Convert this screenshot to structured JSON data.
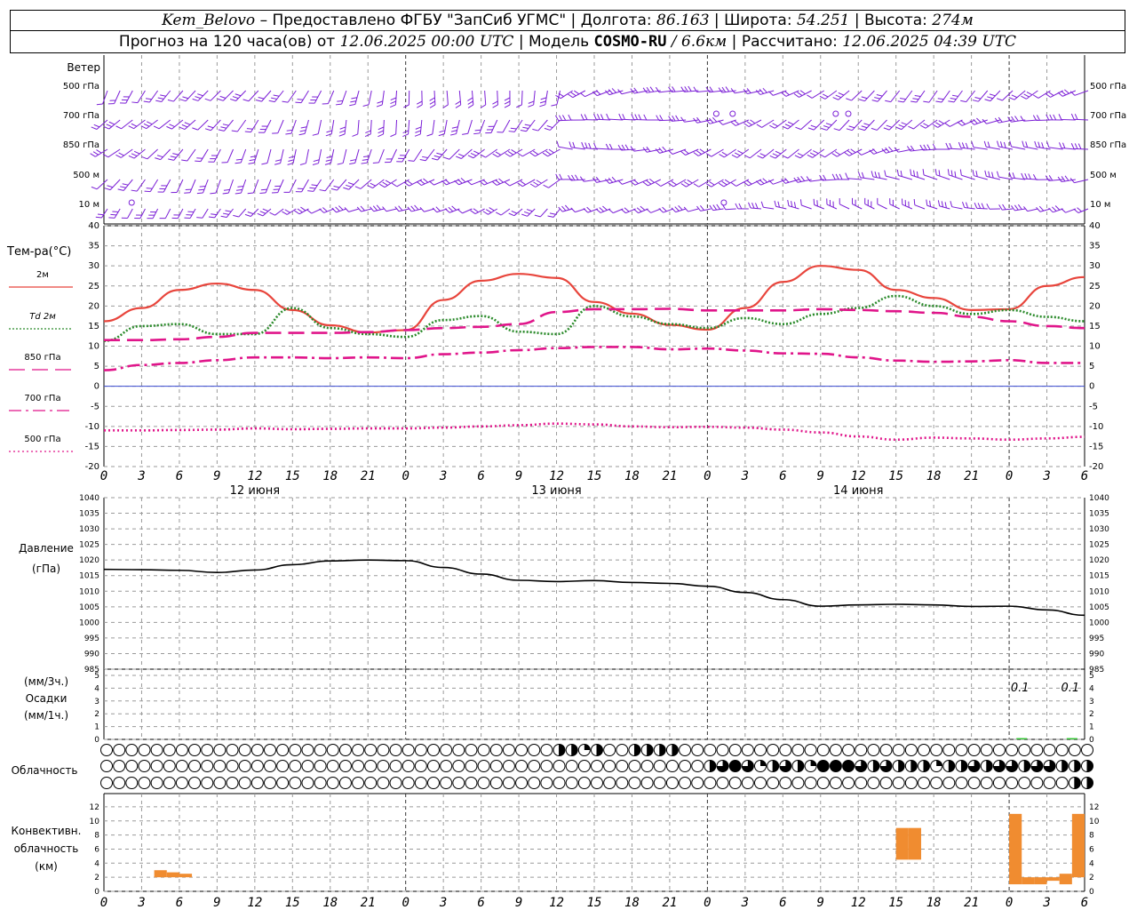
{
  "header": {
    "station": "Kem_Belovo",
    "provider": "– Предоставлено ФГБУ \"ЗапСиб УГМС\"",
    "lon_label": "Долгота:",
    "lon_value": "86.163",
    "lat_label": "Широта:",
    "lat_value": "54.251",
    "alt_label": "Высота:",
    "alt_value": "274м",
    "forecast_label": "Прогноз на 120 часа(ов) от",
    "forecast_start": "12.06.2025 00:00 UTC",
    "model_label": "Модель",
    "model_name": "COSMO-RU",
    "model_res": "/ 6.6км",
    "computed_label": "Рассчитано:",
    "computed_time": "12.06.2025 04:39 UTC"
  },
  "wind_panel": {
    "title": "Ветер",
    "levels": [
      "500 гПа",
      "700 гПа",
      "850 гПа",
      "500 м",
      "10 м"
    ]
  },
  "colors": {
    "wind": "#7b1fd6",
    "t2m": "#e8453c",
    "td2m": "#2a8a2a",
    "magenta": "#e0158a",
    "pressure": "#000000",
    "precip": "#2fc42f",
    "conv": "#f08c30",
    "grid": "#9a9a9a",
    "zero_line": "#3a4ad0"
  },
  "time_axis": {
    "hour_ticks": [
      "0",
      "3",
      "6",
      "9",
      "12",
      "15",
      "18",
      "21",
      "0",
      "3",
      "6",
      "9",
      "12",
      "15",
      "18",
      "21",
      "0",
      "3",
      "6",
      "9",
      "12",
      "15",
      "18",
      "21",
      "0",
      "3",
      "6"
    ],
    "days": [
      "12 июня",
      "13 июня",
      "14 июня"
    ]
  },
  "chart_data": [
    {
      "type": "line",
      "title": "Тем-ра(°C)",
      "x_hours": [
        0,
        3,
        6,
        9,
        12,
        15,
        18,
        21,
        24,
        27,
        30,
        33,
        36,
        39,
        42,
        45,
        48,
        51,
        54,
        57,
        60,
        63,
        66,
        69,
        72,
        75,
        78
      ],
      "ylim": [
        -20,
        40
      ],
      "y_ticks": [
        -20,
        -15,
        -10,
        -5,
        0,
        5,
        10,
        15,
        20,
        25,
        30,
        35,
        40
      ],
      "series": [
        {
          "name": "2м",
          "style": "solid",
          "values": [
            16.2,
            19.5,
            24,
            25.6,
            24,
            19,
            15.2,
            13.4,
            14,
            21.5,
            26.3,
            28,
            27,
            21,
            18.1,
            15.3,
            14.1,
            19.5,
            26,
            30,
            29,
            24,
            22,
            19,
            19.2,
            25,
            27.2
          ]
        },
        {
          "name": "Td 2м",
          "style": "dotted",
          "values": [
            11.3,
            15,
            15.5,
            13,
            13,
            19.5,
            14.5,
            13,
            12.3,
            16.5,
            17.5,
            13.6,
            13,
            20,
            17.4,
            15.5,
            14.5,
            17,
            15.5,
            18,
            19.5,
            22.5,
            20,
            18,
            19,
            17.3,
            16.2
          ]
        },
        {
          "name": "850 гПа",
          "style": "dash",
          "values": [
            11.5,
            11.5,
            11.7,
            12.3,
            13.3,
            13.3,
            13.3,
            13.5,
            14,
            14.5,
            14.8,
            15.5,
            18.5,
            19.2,
            19.2,
            19.3,
            18.9,
            18.9,
            18.9,
            19.2,
            19,
            18.7,
            18.3,
            17.3,
            16.2,
            15,
            14.5
          ]
        },
        {
          "name": "700 гПа",
          "style": "dashdot",
          "values": [
            4,
            5.3,
            5.8,
            6.5,
            7.2,
            7.2,
            7,
            7.2,
            7,
            8,
            8.4,
            9,
            9.5,
            9.8,
            9.8,
            9.2,
            9.4,
            8.9,
            8.2,
            8.1,
            7.2,
            6.4,
            6.1,
            6.2,
            6.5,
            5.8,
            5.8
          ]
        },
        {
          "name": "500 гПа",
          "style": "dotted",
          "values": [
            -11,
            -11,
            -10.9,
            -10.8,
            -10.5,
            -10.7,
            -10.6,
            -10.5,
            -10.5,
            -10.3,
            -10,
            -9.7,
            -9.3,
            -9.5,
            -10,
            -10.2,
            -10.1,
            -10.3,
            -10.8,
            -11.5,
            -12.5,
            -13.3,
            -12.8,
            -13,
            -13.3,
            -13,
            -12.6
          ]
        }
      ]
    },
    {
      "type": "line",
      "title": "Давление",
      "unit": "(гПа)",
      "x_hours": [
        0,
        3,
        6,
        9,
        12,
        15,
        18,
        21,
        24,
        27,
        30,
        33,
        36,
        39,
        42,
        45,
        48,
        51,
        54,
        57,
        60,
        63,
        66,
        69,
        72,
        75,
        78
      ],
      "ylim": [
        985,
        1040
      ],
      "y_ticks": [
        985,
        990,
        995,
        1000,
        1005,
        1010,
        1015,
        1020,
        1025,
        1030,
        1035,
        1040
      ],
      "series": [
        {
          "name": "Давление",
          "values": [
            1017,
            1016.9,
            1016.7,
            1016,
            1016.8,
            1018.5,
            1019.7,
            1020,
            1019.8,
            1017.6,
            1015.5,
            1013.5,
            1013.1,
            1013.4,
            1012.8,
            1012.5,
            1011.6,
            1009.6,
            1007.3,
            1005.2,
            1005.6,
            1005.8,
            1005.6,
            1005.1,
            1005.2,
            1004,
            1002.3
          ]
        }
      ]
    },
    {
      "type": "bar",
      "title": "Осадки",
      "unit_3h": "(мм/3ч.)",
      "unit_1h": "(мм/1ч.)",
      "ylim": [
        0,
        5
      ],
      "y_ticks": [
        0,
        1,
        2,
        3,
        4,
        5
      ],
      "bars": [
        {
          "x_hour": 73,
          "value": 0.1,
          "label": "0.1"
        },
        {
          "x_hour": 77,
          "value": 0.1,
          "label": "0.1"
        }
      ]
    },
    {
      "type": "table",
      "title": "Облачность",
      "rows": 3,
      "x_hours": [
        0,
        1,
        2,
        3,
        4,
        5,
        6,
        7,
        8,
        9,
        10,
        11,
        12,
        13,
        14,
        15,
        16,
        17,
        18,
        19,
        20,
        21,
        22,
        23,
        24,
        25,
        26,
        27,
        28,
        29,
        30,
        31,
        32,
        33,
        34,
        35,
        36,
        37,
        38,
        39,
        40,
        41,
        42,
        43,
        44,
        45,
        46,
        47,
        48,
        49,
        50,
        51,
        52,
        53,
        54,
        55,
        56,
        57,
        58,
        59,
        60,
        61,
        62,
        63,
        64,
        65,
        66,
        67,
        68,
        69,
        70,
        71,
        72,
        73,
        74,
        75,
        76,
        77,
        78
      ],
      "cover_fraction": [
        [
          0,
          0,
          0,
          0,
          0,
          0,
          0,
          0,
          0,
          0,
          0,
          0,
          0,
          0,
          0,
          0,
          0,
          0,
          0,
          0,
          0,
          0,
          0,
          0,
          0,
          0,
          0,
          0,
          0,
          0,
          0,
          0,
          0,
          0,
          0,
          0,
          0.5,
          0.5,
          0.25,
          0.5,
          0,
          0,
          0.5,
          0.5,
          0.5,
          0.5,
          0,
          0,
          0,
          0,
          0,
          0,
          0,
          0,
          0,
          0,
          0,
          0,
          0,
          0,
          0,
          0,
          0,
          0,
          0,
          0,
          0,
          0,
          0,
          0,
          0,
          0,
          0,
          0,
          0,
          0,
          0,
          0,
          0
        ],
        [
          0,
          0,
          0,
          0,
          0,
          0,
          0,
          0,
          0,
          0,
          0,
          0,
          0,
          0,
          0,
          0,
          0,
          0,
          0,
          0,
          0,
          0,
          0,
          0,
          0,
          0,
          0,
          0,
          0,
          0,
          0,
          0,
          0,
          0,
          0,
          0,
          0,
          0,
          0,
          0,
          0,
          0,
          0,
          0,
          0,
          0,
          0,
          0,
          0.5,
          0.75,
          1,
          0.75,
          0.25,
          0.5,
          0.75,
          0.5,
          0.25,
          1,
          1,
          1,
          0.75,
          0.5,
          0.75,
          0.5,
          0.5,
          0.5,
          0.25,
          0.5,
          0.5,
          0.75,
          0.5,
          0.75,
          0.75,
          0.5,
          0.75,
          0.75,
          0.5,
          0.5,
          0.5
        ],
        [
          0,
          0,
          0,
          0,
          0,
          0,
          0,
          0,
          0,
          0,
          0,
          0,
          0,
          0,
          0,
          0,
          0,
          0,
          0,
          0,
          0,
          0,
          0,
          0,
          0,
          0,
          0,
          0,
          0,
          0,
          0,
          0,
          0,
          0,
          0,
          0,
          0,
          0,
          0,
          0,
          0,
          0,
          0,
          0,
          0,
          0,
          0,
          0,
          0,
          0,
          0,
          0,
          0,
          0,
          0,
          0,
          0,
          0,
          0,
          0,
          0,
          0,
          0,
          0,
          0,
          0,
          0,
          0,
          0,
          0,
          0,
          0,
          0,
          0,
          0,
          0,
          0,
          0.5,
          0.5
        ]
      ]
    },
    {
      "type": "bar",
      "title": "Конвективн. облачность",
      "unit": "(км)",
      "ylim": [
        0,
        13
      ],
      "y_ticks": [
        0,
        2,
        4,
        6,
        8,
        10,
        12
      ],
      "bars": [
        {
          "x_hour": 4.5,
          "base": 2,
          "top": 3
        },
        {
          "x_hour": 5.5,
          "base": 2,
          "top": 2.7
        },
        {
          "x_hour": 6.5,
          "base": 2,
          "top": 2.5
        },
        {
          "x_hour": 63.5,
          "base": 4.5,
          "top": 9
        },
        {
          "x_hour": 64.5,
          "base": 4.5,
          "top": 9
        },
        {
          "x_hour": 72.5,
          "base": 1,
          "top": 11
        },
        {
          "x_hour": 73.5,
          "base": 1,
          "top": 2
        },
        {
          "x_hour": 74.5,
          "base": 1,
          "top": 2
        },
        {
          "x_hour": 75.5,
          "base": 1.5,
          "top": 2
        },
        {
          "x_hour": 76.5,
          "base": 1,
          "top": 2.5
        },
        {
          "x_hour": 77.5,
          "base": 2,
          "top": 11
        }
      ]
    }
  ]
}
